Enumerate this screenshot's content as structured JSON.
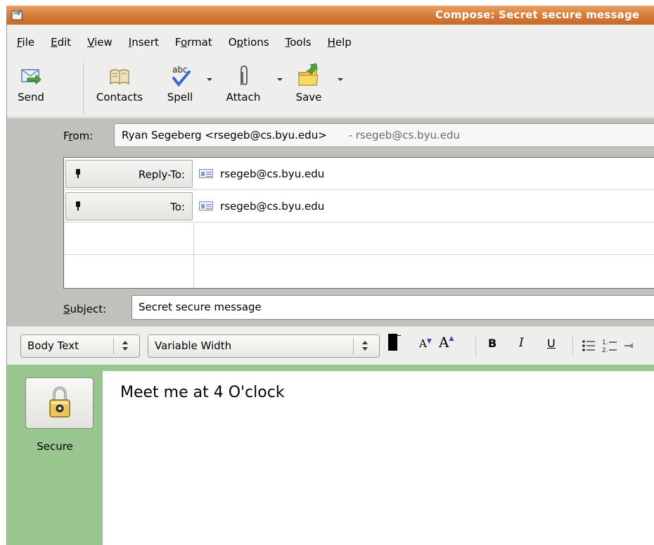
{
  "window": {
    "title": "Compose: Secret secure message"
  },
  "menubar": {
    "items": [
      {
        "label": "File"
      },
      {
        "label": "Edit"
      },
      {
        "label": "View"
      },
      {
        "label": "Insert"
      },
      {
        "label": "Format"
      },
      {
        "label": "Options"
      },
      {
        "label": "Tools"
      },
      {
        "label": "Help"
      }
    ]
  },
  "toolbar": {
    "send_label": "Send",
    "contacts_label": "Contacts",
    "spell_label": "Spell",
    "spell_icon_text": "abc",
    "attach_label": "Attach",
    "save_label": "Save"
  },
  "header": {
    "from_label": "From:",
    "from_value": "Ryan Segeberg <rsegeb@cs.byu.edu>",
    "from_alias": "- rsegeb@cs.byu.edu",
    "recipients": [
      {
        "type": "Reply-To:",
        "address": "rsegeb@cs.byu.edu"
      },
      {
        "type": "To:",
        "address": "rsegeb@cs.byu.edu"
      }
    ],
    "subject_label": "Subject:",
    "subject_value": "Secret secure message"
  },
  "formatbar": {
    "paragraph_style": "Body Text",
    "font": "Variable Width",
    "text_color": "#000000",
    "smaller_label": "A",
    "larger_label": "A",
    "bold_label": "B",
    "italic_label": "I",
    "underline_label": "U"
  },
  "body": {
    "secure_label": "Secure",
    "message": "Meet me at 4 O'clock"
  },
  "colors": {
    "titlebar": "#d47a36",
    "secure_panel": "#99c68e",
    "header_bg": "#c0c0bd"
  }
}
